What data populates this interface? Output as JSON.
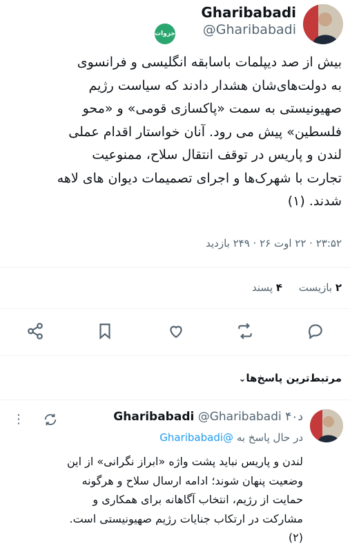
{
  "author": {
    "name": "Gharibabadi",
    "handle": "@Gharibabadi",
    "badge_label": "جزوات"
  },
  "tweet": {
    "text": "بیش از صد دیپلمات باسابقه انگلیسی و فرانسوی\nبه دولت‌های‌شان هشدار دادند که سیاست رژیم\nصهیونیستی به سمت «پاکسازی قومی» و «محو\nفلسطین» پیش می رود. آنان خواستار اقدام عملی\nلندن و پاریس در توقف انتقال سلاح، ممنوعیت\nتجارت با شهرک‌ها و اجرای تصمیمات دیوان های لاهه\nشدند. (۱)",
    "meta": "۲۳:۵۲ · ۲۲ اوت ۲۶ · ۲۴۹ بازدید"
  },
  "stats": {
    "reposts_count": "۲",
    "reposts_label": "بازیست",
    "likes_count": "۴",
    "likes_label": "پسند"
  },
  "actions": [
    "reply-icon",
    "repost-icon",
    "like-icon",
    "bookmark-icon",
    "share-icon"
  ],
  "sort": {
    "label": "مرتبط‌ترین پاسخ‌ها"
  },
  "reply": {
    "name": "Gharibabadi",
    "handle": "@Gharibabadi",
    "time": "۴۰د",
    "replying_prefix": "در حال پاسخ به",
    "replying_to": "@Gharibabadi",
    "text": "لندن و پاریس نباید پشت واژه «ابراز نگرانی» از این\nوضعیت پنهان شوند؛ ادامه ارسال سلاح و هرگونه\nحمایت از رژیم، انتخاب آگاهانه برای همکاری و\nمشارکت در ارتکاب جنایات رژیم صهیونیستی است.\n(۲)"
  },
  "colors": {
    "accent": "#1d9bf0",
    "muted": "#536471",
    "text": "#0f1419"
  }
}
